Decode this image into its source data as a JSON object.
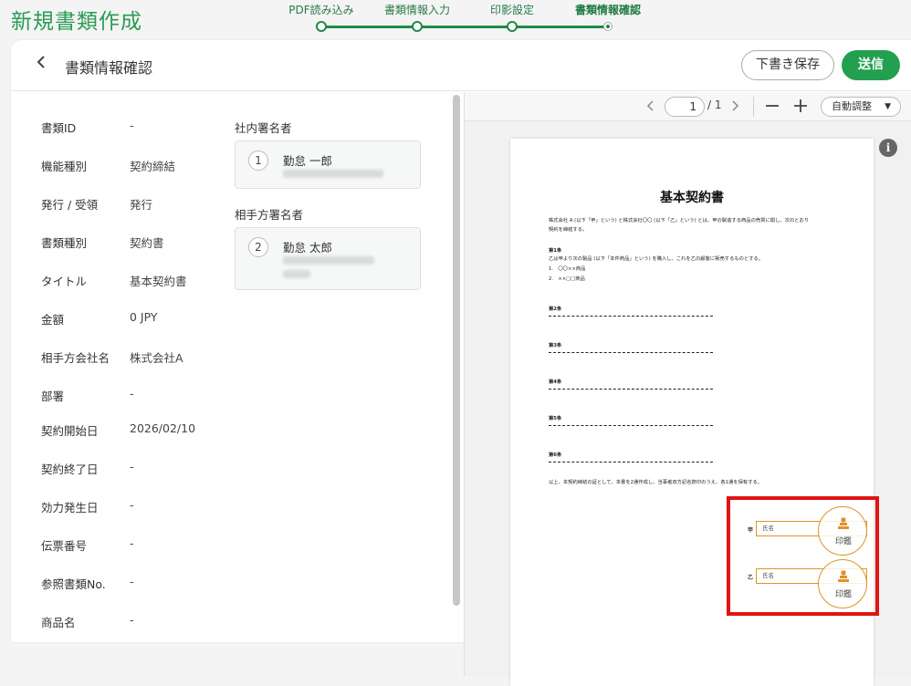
{
  "app": {
    "title": "新規書類作成"
  },
  "stepper": {
    "steps": [
      {
        "label": "PDF読み込み"
      },
      {
        "label": "書類情報入力"
      },
      {
        "label": "印影設定"
      },
      {
        "label": "書類情報確認"
      }
    ]
  },
  "header": {
    "title": "書類情報確認",
    "draft_label": "下書き保存",
    "send_label": "送信"
  },
  "fields": [
    {
      "label": "書類ID",
      "value": "-"
    },
    {
      "label": "機能種別",
      "value": "契約締結"
    },
    {
      "label": "発行 / 受領",
      "value": "発行"
    },
    {
      "label": "書類種別",
      "value": "契約書"
    },
    {
      "label": "タイトル",
      "value": "基本契約書"
    },
    {
      "label": "金額",
      "value": "0 JPY"
    },
    {
      "label": "相手方会社名",
      "value": "株式会社A"
    },
    {
      "label": "部署",
      "value": "-"
    },
    {
      "label": "契約開始日",
      "value": "2026/02/10"
    },
    {
      "label": "契約終了日",
      "value": "-"
    },
    {
      "label": "効力発生日",
      "value": "-"
    },
    {
      "label": "伝票番号",
      "value": "-"
    },
    {
      "label": "参照書類No.",
      "value": "-"
    },
    {
      "label": "商品名",
      "value": "-"
    }
  ],
  "signers": {
    "internal_title": "社内署名者",
    "internal": {
      "number": "1",
      "name": "勤怠 一郎"
    },
    "counterparty_title": "相手方署名者",
    "counterparty": {
      "number": "2",
      "name": "勤怠 太郎"
    }
  },
  "viewer": {
    "page_current": "1",
    "page_total": "/ 1",
    "zoom_label": "自動調整",
    "info_glyph": "i"
  },
  "document": {
    "title": "基本契約書",
    "intro_1": "株式会社 A (以下「甲」という) と株式会社〇〇 (以下「乙」という) とは、甲の製造する商品の売買に関し、次のとおり",
    "intro_2": "契約を締結する。",
    "art1_head": "第1条",
    "art1_line": "乙は甲より次の製品 (以下「本件商品」という) を購入し、これを乙の顧客に販売するものとする。",
    "art1_item1": "1.　〇〇××商品",
    "art1_item2": "2.　××□□商品",
    "art2_head": "第2条",
    "art3_head": "第3条",
    "art4_head": "第4条",
    "art5_head": "第5条",
    "art6_head": "第6条",
    "closing": "以上、本契約締結の証として、本書を2通作成し、当事者双方記名捺印のうえ、各1通を保有する。",
    "party_a": "甲",
    "party_b": "乙",
    "name_placeholder": "氏名",
    "seal_label": "印鑑"
  },
  "colors": {
    "brand_green": "#22a050",
    "seal_orange": "#e0922a",
    "highlight_red": "#e21313"
  }
}
